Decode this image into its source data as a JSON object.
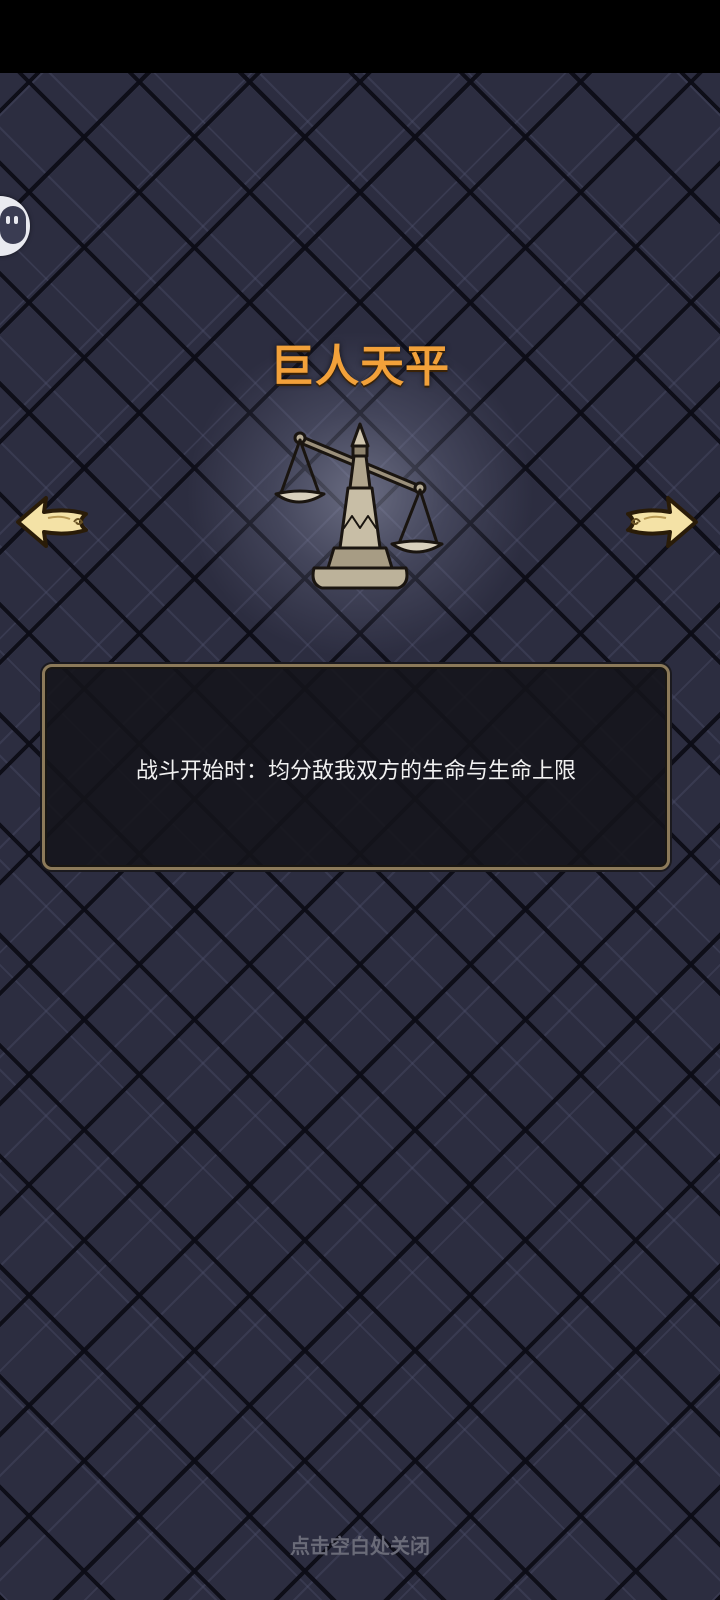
{
  "relic": {
    "name": "巨人天平",
    "description": "战斗开始时：均分敌我双方的生命与生命上限",
    "icon": "balance-scale-icon"
  },
  "navigation": {
    "prev_icon": "arrow-left-icon",
    "next_icon": "arrow-right-icon"
  },
  "footer": {
    "close_hint": "点击空白处关闭"
  },
  "floating_button": {
    "icon": "assistant-face-icon"
  },
  "colors": {
    "title": "#f2a13a",
    "arrow_fill": "#f4e2a6",
    "panel_border": "#8c7a5a",
    "background": "#2c2d40"
  }
}
